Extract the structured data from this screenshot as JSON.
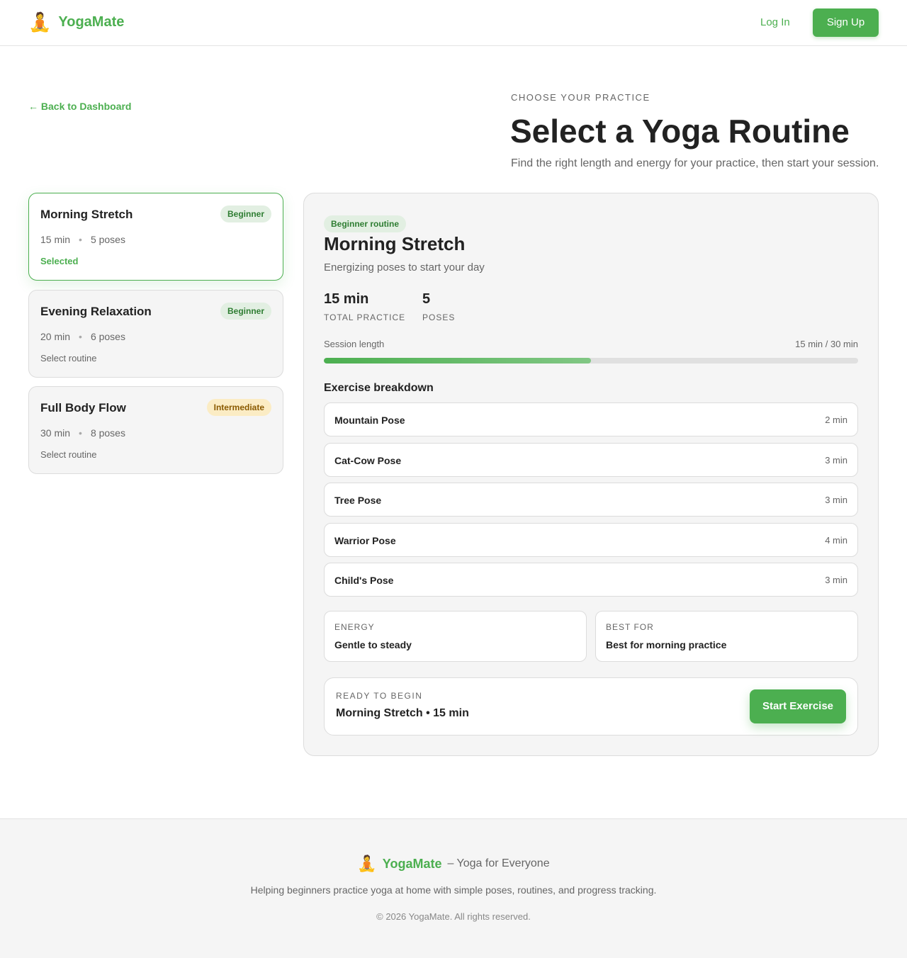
{
  "header": {
    "brand_icon": "🧘",
    "brand_name": "YogaMate",
    "login_label": "Log In",
    "signup_label": "Sign Up"
  },
  "back_link": "← Back to Dashboard",
  "hero": {
    "eyebrow": "CHOOSE YOUR PRACTICE",
    "title": "Select a Yoga Routine",
    "subtitle": "Find the right length and energy for your practice, then start your session."
  },
  "routines": [
    {
      "title": "Morning Stretch",
      "badge": "Beginner",
      "duration": "15 min",
      "poses": "5 poses",
      "status": "Selected"
    },
    {
      "title": "Evening Relaxation",
      "badge": "Beginner",
      "duration": "20 min",
      "poses": "6 poses",
      "status": "Select routine"
    },
    {
      "title": "Full Body Flow",
      "badge": "Intermediate",
      "duration": "30 min",
      "poses": "8 poses",
      "status": "Select routine"
    }
  ],
  "detail": {
    "badge": "Beginner routine",
    "title": "Morning Stretch",
    "description": "Energizing poses to start your day",
    "stats": [
      {
        "value": "15 min",
        "label": "TOTAL PRACTICE"
      },
      {
        "value": "5",
        "label": "POSES"
      }
    ],
    "session_length_label": "Session length",
    "session_length_value": "15 min / 30 min",
    "session_progress": 0.5,
    "breakdown_title": "Exercise breakdown",
    "exercises": [
      {
        "name": "Mountain Pose",
        "duration": "2 min"
      },
      {
        "name": "Cat-Cow Pose",
        "duration": "3 min"
      },
      {
        "name": "Tree Pose",
        "duration": "3 min"
      },
      {
        "name": "Warrior Pose",
        "duration": "4 min"
      },
      {
        "name": "Child's Pose",
        "duration": "3 min"
      }
    ],
    "energy_label": "ENERGY",
    "energy_value": "Gentle to steady",
    "best_for_label": "BEST FOR",
    "best_for_value": "Best for morning practice",
    "ready_label": "READY TO BEGIN",
    "ready_value": "Morning Stretch • 15 min",
    "start_label": "Start Exercise"
  },
  "footer": {
    "brand_icon": "🧘",
    "brand_name": "YogaMate",
    "tagline": "– Yoga for Everyone",
    "description": "Helping beginners practice yoga at home with simple poses, routines, and progress tracking.",
    "copyright": "© 2026 YogaMate. All rights reserved."
  },
  "colors": {
    "accent": "#4caf50",
    "beginner_badge_bg": "#e2efe2",
    "intermediate_badge_bg": "#fbecc4"
  }
}
